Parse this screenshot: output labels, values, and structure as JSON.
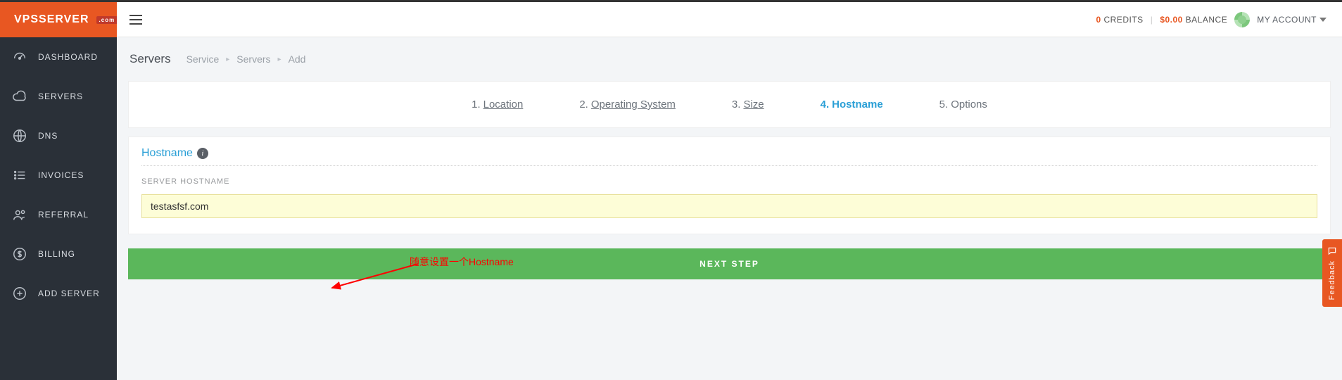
{
  "brand": {
    "name": "VPSSERVER",
    "badge": ".com"
  },
  "sidebar": {
    "items": [
      {
        "label": "DASHBOARD"
      },
      {
        "label": "SERVERS"
      },
      {
        "label": "DNS"
      },
      {
        "label": "INVOICES"
      },
      {
        "label": "REFERRAL"
      },
      {
        "label": "BILLING"
      },
      {
        "label": "ADD SERVER"
      }
    ]
  },
  "topbar": {
    "credits_count": "0",
    "credits_label": " CREDITS",
    "balance_amount": "$0.00",
    "balance_label": " BALANCE",
    "account_label": "MY ACCOUNT"
  },
  "breadcrumb": {
    "title": "Servers",
    "crumb1": "Service",
    "crumb2": "Servers",
    "crumb3": "Add"
  },
  "steps": [
    {
      "num": "1.",
      "label": "Location"
    },
    {
      "num": "2.",
      "label": "Operating System"
    },
    {
      "num": "3.",
      "label": "Size"
    },
    {
      "num": "4.",
      "label": "Hostname"
    },
    {
      "num": "5.",
      "label": "Options"
    }
  ],
  "hostname_card": {
    "title": "Hostname",
    "field_label": "SERVER HOSTNAME",
    "value": "testasfsf.com"
  },
  "next_button": "NEXT STEP",
  "annotation": "随意设置一个Hostname",
  "feedback": "Feedback"
}
